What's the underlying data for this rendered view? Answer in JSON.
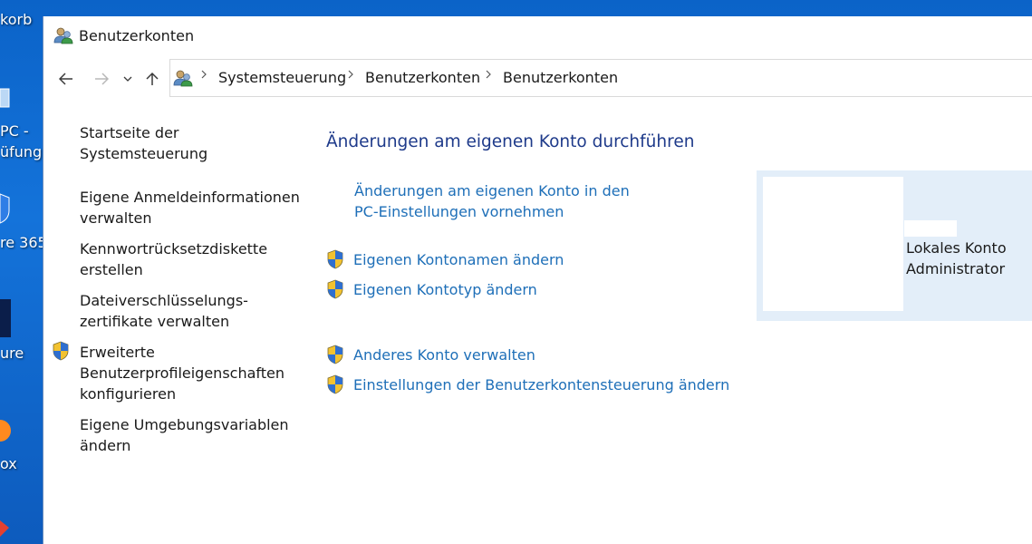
{
  "desktop": {
    "labels": [
      "korb",
      "PC -",
      "üfung",
      "re 365",
      "ure",
      "ox"
    ]
  },
  "window": {
    "title": "Benutzerkonten",
    "title_icon": "user-accounts-icon"
  },
  "navbar": {
    "back_icon": "back-arrow-icon",
    "forward_icon": "forward-arrow-icon",
    "recent_icon": "chevron-down-icon",
    "up_icon": "up-arrow-icon",
    "breadcrumbs": [
      "Systemsteuerung",
      "Benutzerkonten",
      "Benutzerkonten"
    ]
  },
  "sidebar": {
    "home": {
      "line1": "Startseite der",
      "line2": "Systemsteuerung"
    },
    "items": [
      {
        "line1": "Eigene Anmeldeinformationen",
        "line2": "verwalten",
        "shield": false
      },
      {
        "line1": "Kennwortrücksetzdiskette",
        "line2": "erstellen",
        "shield": false
      },
      {
        "line1": "Dateiverschlüsselungs-",
        "line2": "zertifikate verwalten",
        "shield": false
      },
      {
        "line1": "Erweiterte",
        "line2": "Benutzerprofileigenschaften",
        "line3": "konfigurieren",
        "shield": true
      },
      {
        "line1": "Eigene Umgebungsvariablen",
        "line2": "ändern",
        "shield": false
      }
    ]
  },
  "main": {
    "heading": "Änderungen am eigenen Konto durchführen",
    "pc_settings_link": {
      "line1": "Änderungen am eigenen Konto in den",
      "line2": "PC-Einstellungen vornehmen"
    },
    "tasks": [
      "Eigenen Kontonamen ändern",
      "Eigenen Kontotyp ändern",
      "Anderes Konto verwalten",
      "Einstellungen der Benutzerkontensteuerung ändern"
    ]
  },
  "account": {
    "type": "Lokales Konto",
    "role": "Administrator"
  },
  "colors": {
    "link": "#1e6fb8",
    "heading": "#1e3a8a",
    "tile_bg": "#e3eef9",
    "desktop": "#0b63c8"
  }
}
